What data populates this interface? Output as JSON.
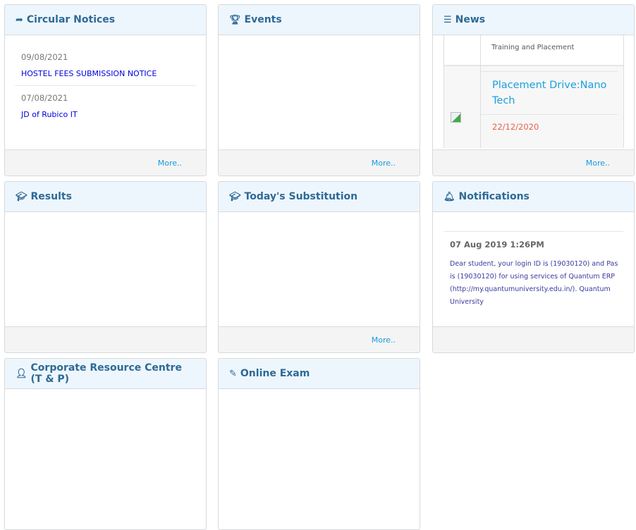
{
  "circular": {
    "title": "Circular Notices",
    "icon": "share-icon",
    "items": [
      {
        "date": "09/08/2021",
        "text": "HOSTEL FEES SUBMISSION NOTICE"
      },
      {
        "date": "07/08/2021",
        "text": "JD of Rubico IT"
      }
    ],
    "more": "More.."
  },
  "events": {
    "title": "Events",
    "icon": "trophy-icon",
    "more": "More.."
  },
  "news": {
    "title": "News",
    "icon": "list-icon",
    "category": "Training and Placement",
    "item_title": "Placement Drive:Nano Tech",
    "item_date": "22/12/2020",
    "more": "More.."
  },
  "results": {
    "title": "Results",
    "icon": "graduation-cap-icon"
  },
  "substitution": {
    "title": "Today's Substitution",
    "icon": "graduation-cap-icon",
    "more": "More.."
  },
  "notifications": {
    "title": "Notifications",
    "icon": "bell-icon",
    "date": "07 Aug 2019 1:26PM",
    "lines": [
      "Dear student, your login ID is (19030120) and Pas",
      "is (19030120) for using services of Quantum ERP",
      "(http://my.quantumuniversity.edu.in/). Quantum",
      "University"
    ]
  },
  "crc": {
    "title": "Corporate Resource Centre (T & P)",
    "icon": "user-icon"
  },
  "exam": {
    "title": "Online Exam",
    "icon": "edit-icon"
  }
}
